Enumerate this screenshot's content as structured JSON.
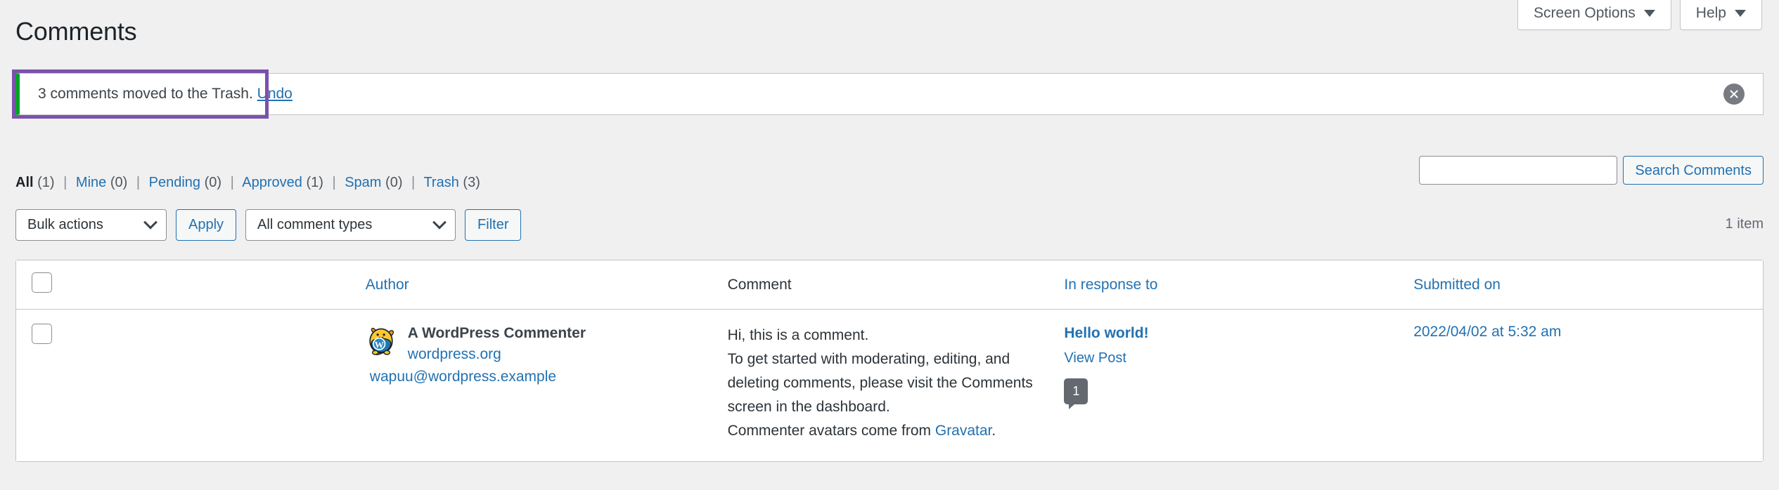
{
  "screen_meta": {
    "tabs": [
      {
        "label": "Screen Options",
        "icon": "chevron-down-icon"
      },
      {
        "label": "Help",
        "icon": "chevron-down-icon"
      }
    ]
  },
  "page": {
    "title": "Comments"
  },
  "notice": {
    "message": "3 comments moved to the Trash.",
    "undo_label": "Undo",
    "accent_color": "#00a32a",
    "focus_outline_color": "#7b52ab",
    "dismiss_icon": "close-icon"
  },
  "filters": {
    "items": [
      {
        "label": "All",
        "count": "(1)",
        "current": true
      },
      {
        "label": "Mine",
        "count": "(0)",
        "current": false
      },
      {
        "label": "Pending",
        "count": "(0)",
        "current": false
      },
      {
        "label": "Approved",
        "count": "(1)",
        "current": false
      },
      {
        "label": "Spam",
        "count": "(0)",
        "current": false
      },
      {
        "label": "Trash",
        "count": "(3)",
        "current": false
      }
    ],
    "separator": "|"
  },
  "search": {
    "value": "",
    "placeholder": "",
    "button_label": "Search Comments"
  },
  "tablenav": {
    "bulk_actions_label": "Bulk actions",
    "apply_label": "Apply",
    "comment_types_label": "All comment types",
    "filter_label": "Filter",
    "displaying_num": "1 item"
  },
  "table": {
    "columns": {
      "author": "Author",
      "comment": "Comment",
      "response": "In response to",
      "date": "Submitted on"
    },
    "rows": [
      {
        "author": {
          "name": "A WordPress Commenter",
          "site": "wordpress.org",
          "email": "wapuu@wordpress.example",
          "avatar_icon": "wapuu-avatar"
        },
        "comment": {
          "line1": "Hi, this is a comment.",
          "line2": "To get started with moderating, editing, and deleting comments, please visit the Comments screen in the dashboard.",
          "line3_prefix": "Commenter avatars come from ",
          "line3_link": "Gravatar",
          "line3_suffix": "."
        },
        "response": {
          "post_title": "Hello world!",
          "view_post_label": "View Post",
          "comment_count": "1"
        },
        "date": "2022/04/02 at 5:32 am"
      }
    ]
  },
  "colors": {
    "link": "#2271b1",
    "page_background": "#f0f0f1",
    "text": "#2c3338",
    "bubble": "#646970"
  }
}
